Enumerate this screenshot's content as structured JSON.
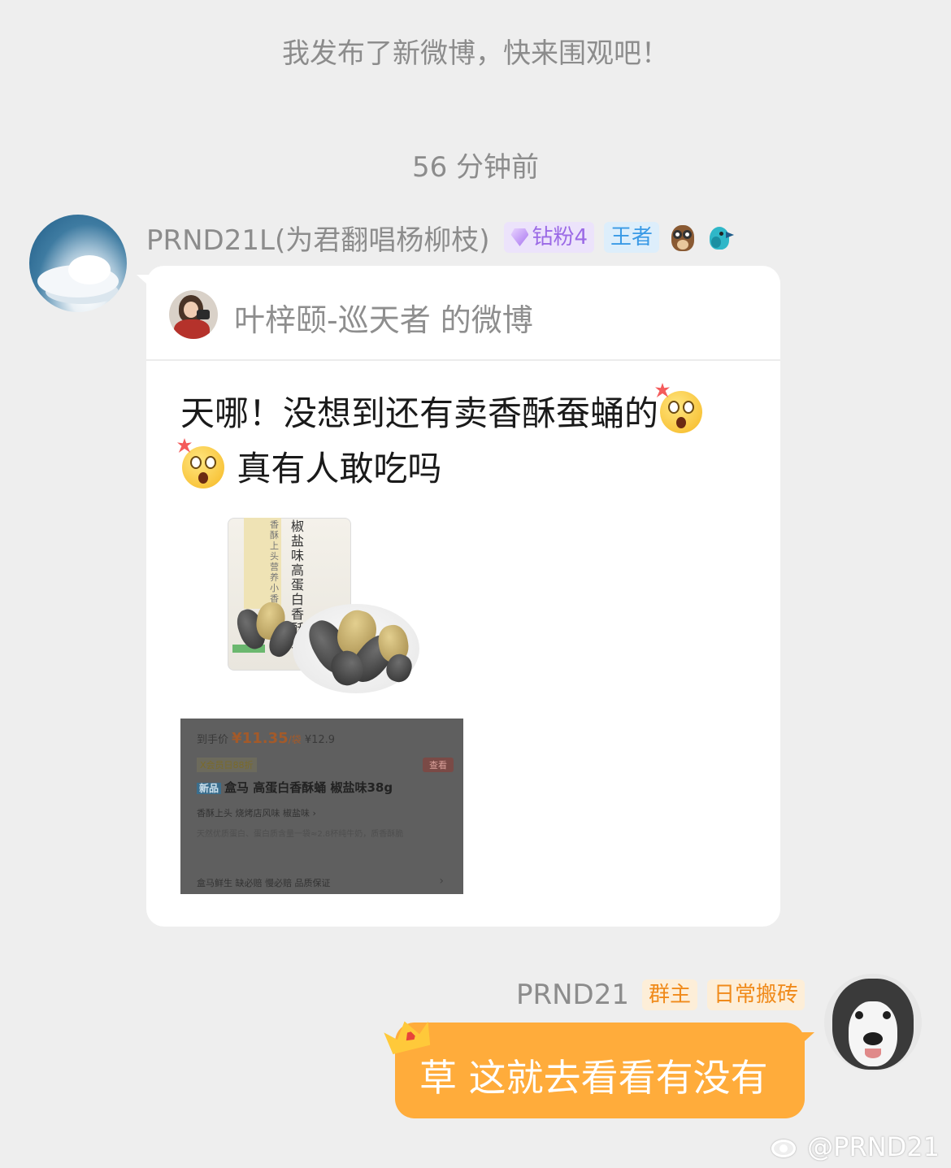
{
  "system": {
    "notice": "我发布了新微博，快来围观吧！",
    "timestamp": "56 分钟前"
  },
  "incoming": {
    "sender_name": "PRND21L(为君翻唱杨柳枝)",
    "badge_fan": "钻粉4",
    "badge_rank": "王者",
    "icons": [
      "owl-icon",
      "bird-icon"
    ],
    "card": {
      "source": "叶梓颐-巡天者 的微博",
      "text_part1": "天哪！没想到还有卖香酥蚕蛹的",
      "text_part2": "真有人敢吃吗",
      "product_image": {
        "vertical_title": "椒盐味高蛋白香酥蛹",
        "vertical_sub": "香酥上头营养小香蛋"
      },
      "shop_screenshot": {
        "price_label": "到手价",
        "price": "¥11.35",
        "price_unit": "/袋",
        "original_price": "¥12.9",
        "member_tag": "X会员日88折",
        "view_button": "查看",
        "new_badge": "新品",
        "product_title": "盒马 高蛋白香酥蛹 椒盐味38g",
        "tags": "香酥上头   烧烤店风味   椒盐味  ›",
        "description": "天然优质蛋白、蛋白质含量一袋≈2.8杯纯牛奶，质香酥脆",
        "footer": "盒马鲜生  缺必赔  慢必赔  品质保证"
      }
    }
  },
  "outgoing": {
    "sender_name": "PRND21",
    "badge_owner": "群主",
    "badge_title": "日常搬砖",
    "message": "草 这就去看看有没有"
  },
  "watermark": "@PRND21",
  "colors": {
    "background": "#eeeeee",
    "bubble_outgoing": "#ffac3b",
    "badge_fan": "#9b6ae6",
    "badge_rank": "#3a9ae6",
    "badge_orange": "#f08a1a"
  }
}
